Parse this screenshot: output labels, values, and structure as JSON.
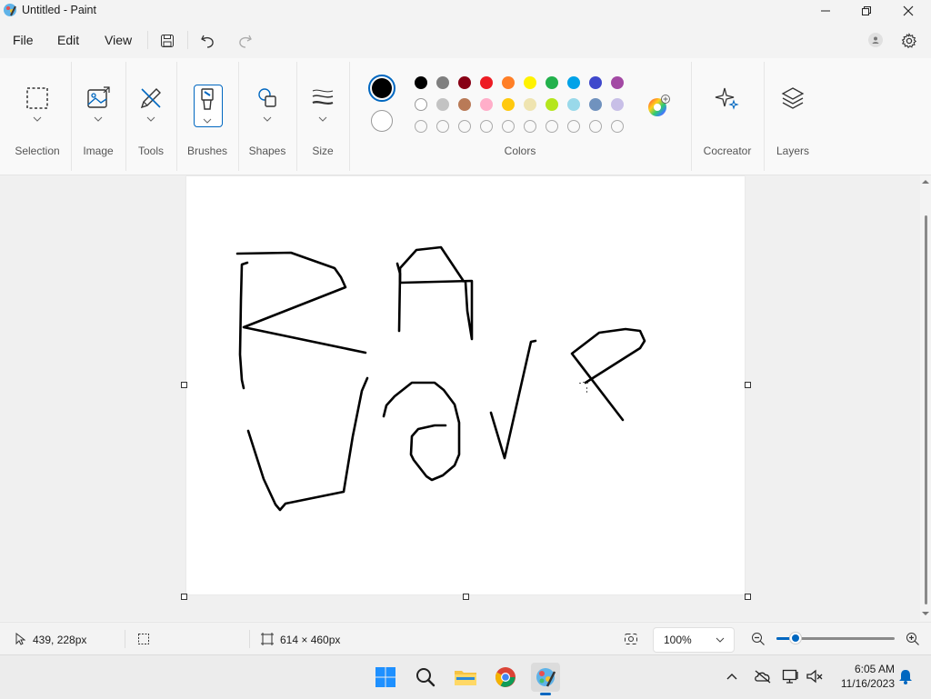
{
  "window": {
    "title": "Untitled - Paint"
  },
  "menu": {
    "file": "File",
    "edit": "Edit",
    "view": "View"
  },
  "ribbon": {
    "selection": "Selection",
    "image": "Image",
    "tools": "Tools",
    "brushes": "Brushes",
    "shapes": "Shapes",
    "size": "Size",
    "colors": "Colors",
    "cocreator": "Cocreator",
    "layers": "Layers"
  },
  "colors": {
    "primary": "#000000",
    "secondary": "#ffffff",
    "row1": [
      "#000000",
      "#7f7f7f",
      "#880015",
      "#ed1c24",
      "#ff7f27",
      "#fff200",
      "#22b14c",
      "#00a2e8",
      "#3f48cc",
      "#a349a4"
    ],
    "row2": [
      "#ffffff",
      "#c3c3c3",
      "#b97a57",
      "#ffaec9",
      "#ffc90e",
      "#efe4b0",
      "#b5e61d",
      "#99d9ea",
      "#7092be",
      "#c8bfe7"
    ],
    "row3_empty_count": 10,
    "accent": "#0067c0"
  },
  "status": {
    "cursor_position": "439, 228px",
    "canvas_size": "614 × 460px",
    "zoom": "100%"
  },
  "taskbar": {
    "time": "6:05 AM",
    "date": "11/16/2023"
  }
}
